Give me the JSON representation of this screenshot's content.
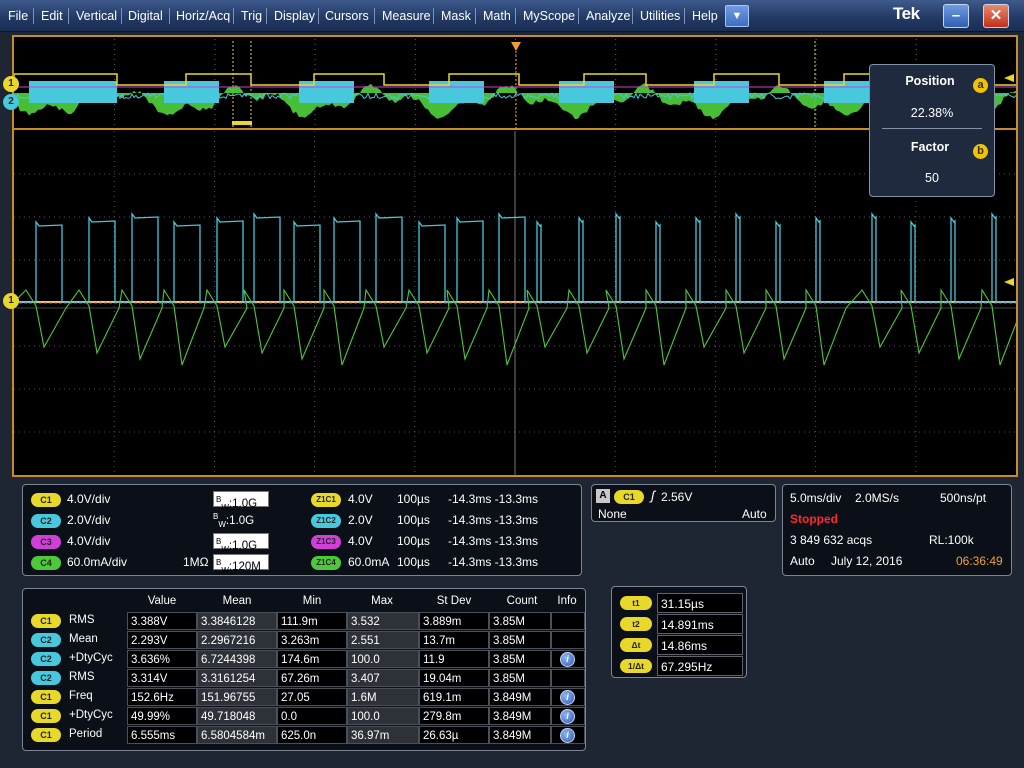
{
  "menu": [
    "File",
    "Edit",
    "Vertical",
    "Digital",
    "Horiz/Acq",
    "Trig",
    "Display",
    "Cursors",
    "Measure",
    "Mask",
    "Math",
    "MyScope",
    "Analyze",
    "Utilities",
    "Help"
  ],
  "brand": "Tek",
  "param_panel": {
    "position_label": "Position",
    "position_value": "22.38%",
    "factor_label": "Factor",
    "factor_value": "50",
    "knob_a": "a",
    "knob_b": "b"
  },
  "markers": {
    "ch1": "1",
    "ch2": "2"
  },
  "channels": [
    {
      "id": "C1",
      "scale": "4.0V/div",
      "term": "",
      "bw_prefix": "B",
      "bw_sub": "W",
      "bw": ":1.0G",
      "bw_boxed": true,
      "color": "#e8d82a"
    },
    {
      "id": "C2",
      "scale": "2.0V/div",
      "term": "",
      "bw_prefix": "B",
      "bw_sub": "W",
      "bw": ":1.0G",
      "bw_boxed": false,
      "color": "#48c8dc"
    },
    {
      "id": "C3",
      "scale": "4.0V/div",
      "term": "",
      "bw_prefix": "B",
      "bw_sub": "W",
      "bw": ":1.0G",
      "bw_boxed": true,
      "color": "#d040d8"
    },
    {
      "id": "C4",
      "scale": "60.0mA/div",
      "term": "1MΩ",
      "bw_prefix": "B",
      "bw_sub": "W",
      "bw": ":120M",
      "bw_boxed": true,
      "color": "#4cc83a"
    }
  ],
  "zoom": [
    {
      "id": "Z1C1",
      "scale": "4.0V",
      "time": "100µs",
      "range": "-14.3ms -13.3ms",
      "color": "#e8d82a"
    },
    {
      "id": "Z1C2",
      "scale": "2.0V",
      "time": "100µs",
      "range": "-14.3ms -13.3ms",
      "color": "#48c8dc"
    },
    {
      "id": "Z1C3",
      "scale": "4.0V",
      "time": "100µs",
      "range": "-14.3ms -13.3ms",
      "color": "#d040d8"
    },
    {
      "id": "Z1C4",
      "scale": "60.0mA",
      "time": "100µs",
      "range": "-14.3ms -13.3ms",
      "color": "#4cc83a"
    }
  ],
  "trigger": {
    "label": "A",
    "source": "C1",
    "slope_symbol": "ʃ",
    "level": "2.56V",
    "coupling": "None",
    "mode": "Auto"
  },
  "acquisition": {
    "timebase": "5.0ms/div",
    "sample_rate": "2.0MS/s",
    "resolution": "500ns/pt",
    "state": "Stopped",
    "acqs": "3 849 632 acqs",
    "record_length": "RL:100k",
    "trigger_mode": "Auto",
    "date": "July 12, 2016",
    "time": "06:36:49"
  },
  "measurements": {
    "headers": [
      "Value",
      "Mean",
      "Min",
      "Max",
      "St Dev",
      "Count",
      "Info"
    ],
    "rows": [
      {
        "src": "C1",
        "name": "RMS",
        "value": "3.388V",
        "mean": "3.3846128",
        "min": "111.9m",
        "max": "3.532",
        "stdev": "3.889m",
        "count": "3.85M",
        "info": false
      },
      {
        "src": "C2",
        "name": "Mean",
        "value": "2.293V",
        "mean": "2.2967216",
        "min": "3.263m",
        "max": "2.551",
        "stdev": "13.7m",
        "count": "3.85M",
        "info": false
      },
      {
        "src": "C2",
        "name": "+DtyCyc",
        "value": "3.636%",
        "mean": "6.7244398",
        "min": "174.6m",
        "max": "100.0",
        "stdev": "11.9",
        "count": "3.85M",
        "info": true
      },
      {
        "src": "C2",
        "name": "RMS",
        "value": "3.314V",
        "mean": "3.3161254",
        "min": "67.26m",
        "max": "3.407",
        "stdev": "19.04m",
        "count": "3.85M",
        "info": false
      },
      {
        "src": "C1",
        "name": "Freq",
        "value": "152.6Hz",
        "mean": "151.96755",
        "min": "27.05",
        "max": "1.6M",
        "stdev": "619.1m",
        "count": "3.849M",
        "info": true
      },
      {
        "src": "C1",
        "name": "+DtyCyc",
        "value": "49.99%",
        "mean": "49.718048",
        "min": "0.0",
        "max": "100.0",
        "stdev": "279.8m",
        "count": "3.849M",
        "info": true
      },
      {
        "src": "C1",
        "name": "Period",
        "value": "6.555ms",
        "mean": "6.5804584m",
        "min": "625.0n",
        "max": "36.97m",
        "stdev": "26.63µ",
        "count": "3.849M",
        "info": true
      }
    ]
  },
  "cursors": [
    {
      "label": "t1",
      "value": "31.15µs"
    },
    {
      "label": "t2",
      "value": "14.891ms"
    },
    {
      "label": "Δt",
      "value": "14.86ms"
    },
    {
      "label": "1/Δt",
      "value": "67.295Hz"
    }
  ],
  "colors": {
    "c1": "#e8d82a",
    "c2": "#48c8dc",
    "c3": "#d040d8",
    "c4": "#4cc83a",
    "frame": "#c88a2d",
    "stopped": "#ff2a2a",
    "clock": "#f0a030"
  }
}
